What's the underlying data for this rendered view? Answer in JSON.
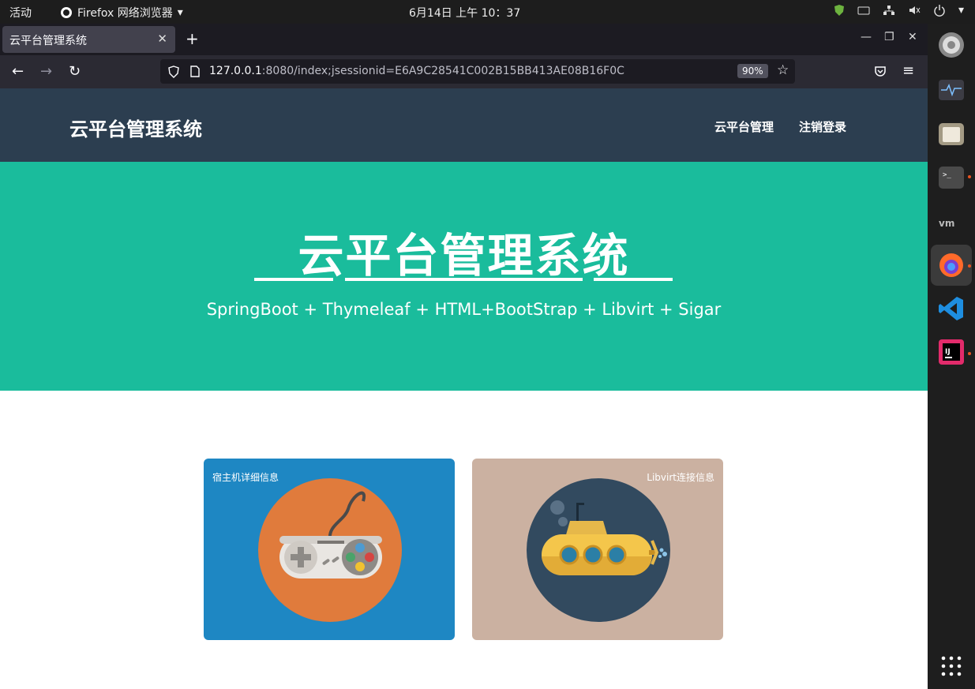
{
  "topbar": {
    "activities": "活动",
    "app_menu": "Firefox 网络浏览器",
    "clock": "6月14日  上午 10：37"
  },
  "browser": {
    "tab_title": "云平台管理系统",
    "url_host": "127.0.0.1",
    "url_rest": ":8080/index;jsessionid=E6A9C28541C002B15BB413AE08B16F0C",
    "zoom": "90%"
  },
  "site": {
    "brand": "云平台管理系统",
    "nav": [
      "云平台管理",
      "注销登录"
    ],
    "hero_title": "云平台管理系统",
    "hero_subtitle": "SpringBoot + Thymeleaf + HTML+BootStrap + Libvirt + Sigar"
  },
  "cards": [
    {
      "label": "宿主机详细信息",
      "bg": "#1e87c3",
      "circle": "#e07b3c"
    },
    {
      "label": "Libvirt连接信息",
      "bg": "#cbb1a1",
      "circle": "#324a5f"
    }
  ],
  "colors": {
    "header": "#2c3e50",
    "hero": "#1abc9c"
  }
}
